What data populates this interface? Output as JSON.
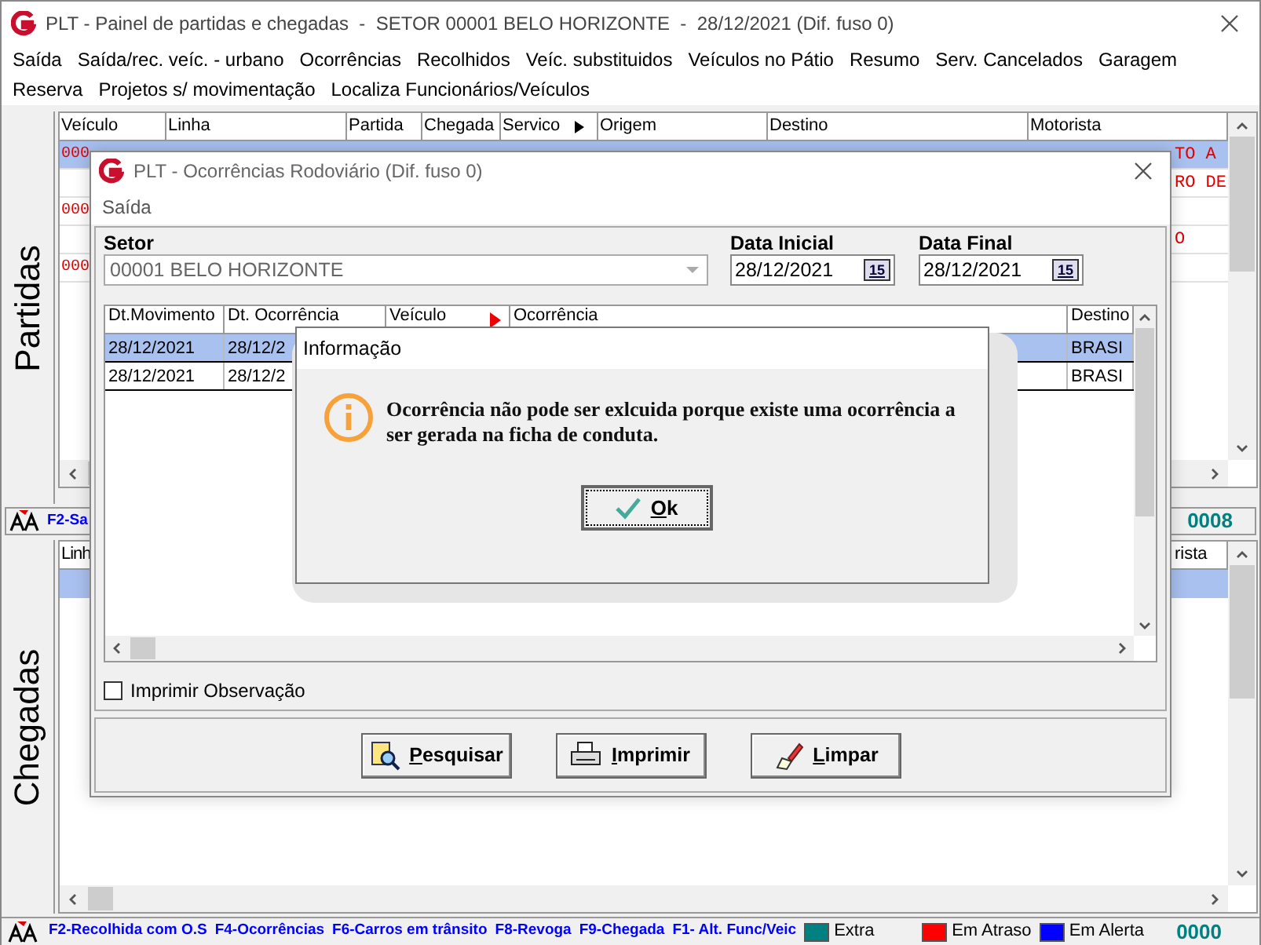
{
  "window": {
    "title": "PLT - Painel de partidas e chegadas  -  SETOR 00001 BELO HORIZONTE  -  28/12/2021 (Dif. fuso 0)"
  },
  "menu": [
    "Saída",
    "Saída/rec. veíc. - urbano",
    "Ocorrências",
    "Recolhidos",
    "Veíc. substituidos",
    "Veículos no Pátio",
    "Resumo",
    "Serv. Cancelados",
    "Garagem",
    "Reserva",
    "Projetos s/ movimentação",
    "Localiza Funcionários/Veículos"
  ],
  "partidas": {
    "tab": "Partidas",
    "columns": [
      "Veículo",
      "Linha",
      "Partida",
      "Chegada",
      "Servico",
      "Origem",
      "Destino",
      "Motorista"
    ],
    "rows": [
      {
        "selected": true,
        "vehicle": "000",
        "driver": "TO A"
      },
      {
        "selected": false,
        "driver": "RO DE"
      },
      {
        "selected": false,
        "vehicle": "000"
      },
      {
        "selected": false,
        "driver": "O"
      },
      {
        "selected": false,
        "vehicle": "000"
      }
    ],
    "shortcut": "F2-Sa",
    "count": "0008"
  },
  "chegadas": {
    "tab": "Chegadas",
    "columns": [
      "Linh",
      "rista"
    ],
    "rows": [
      {
        "selected": true
      }
    ]
  },
  "status_bar": {
    "shortcuts": [
      "F2-Recolhida com O.S",
      "F4-Ocorrências",
      "F6-Carros em trânsito",
      "F8-Revoga",
      "F9-Chegada",
      "F1- Alt. Func/Veic"
    ],
    "legend": [
      {
        "label": "Extra",
        "color": "#008080"
      },
      {
        "label": "Em Atraso",
        "color": "#ff0000"
      },
      {
        "label": "Em Alerta",
        "color": "#0000ff"
      }
    ],
    "count": "0000"
  },
  "occurrences_dialog": {
    "title": "PLT - Ocorrências Rodoviário (Dif. fuso 0)",
    "menu": [
      "Saída"
    ],
    "setor": {
      "label": "Setor",
      "value": "00001 BELO HORIZONTE",
      "disabled": true
    },
    "date_from": {
      "label": "Data Inicial",
      "value": "28/12/2021",
      "calendar": "15"
    },
    "date_to": {
      "label": "Data Final",
      "value": "28/12/2021",
      "calendar": "15"
    },
    "columns": [
      "Dt.Movimento",
      "Dt. Ocorrência",
      "Veículo",
      "Ocorrência",
      "Destino"
    ],
    "rows": [
      {
        "selected": true,
        "dt_movimento": "28/12/2021",
        "dt_ocorrencia": "28/12/2",
        "destino": "BRASI"
      },
      {
        "selected": false,
        "dt_movimento": "28/12/2021",
        "dt_ocorrencia": "28/12/2",
        "destino": "BRASI"
      }
    ],
    "print_notes": {
      "label": "Imprimir Observação",
      "checked": false
    },
    "buttons": [
      {
        "kind": "search",
        "label": "Pesquisar"
      },
      {
        "kind": "print",
        "label": "Imprimir"
      },
      {
        "kind": "clear",
        "label": "Limpar"
      }
    ]
  },
  "info_dialog": {
    "title": "Informação",
    "message": "Ocorrência não pode ser exlcuida porque existe uma ocorrência a ser gerada na ficha de conduta.",
    "button": "Ok"
  }
}
